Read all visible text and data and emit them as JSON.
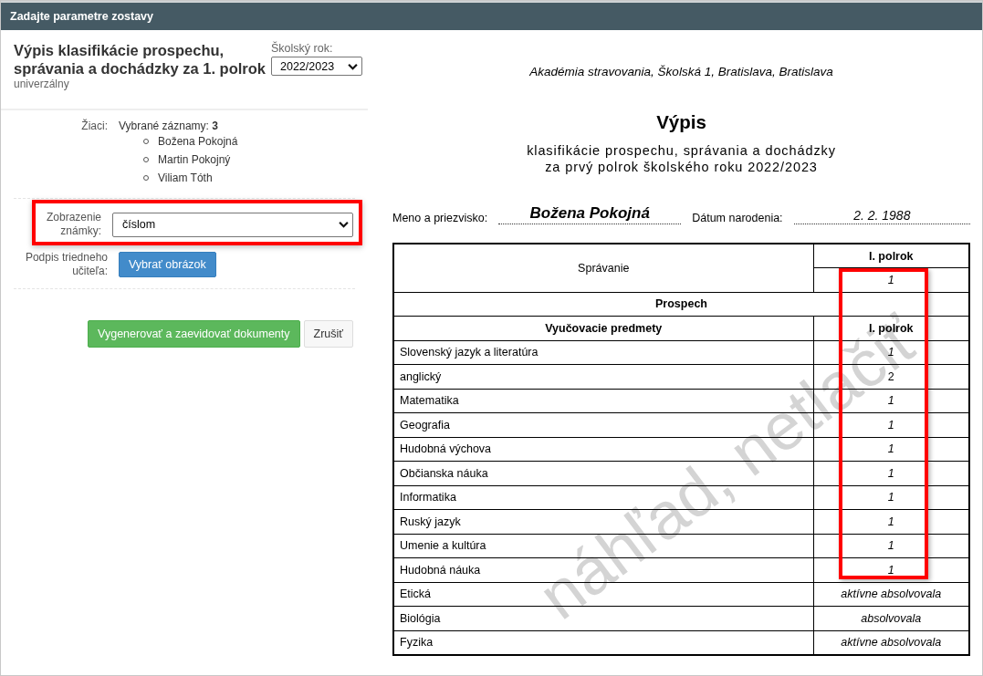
{
  "window": {
    "title": "Zadajte parametre zostavy"
  },
  "params": {
    "heading": "Výpis klasifikácie prospechu, správania a dochádzky za 1. polrok",
    "subtitle": "univerzálny",
    "school_year": {
      "label": "Školský rok:",
      "value": "2022/2023"
    },
    "students": {
      "label": "Žiaci:",
      "summary": "Vybrané záznamy: **3**",
      "names": [
        "Božena Pokojná",
        "Martin Pokojný",
        "Viliam Tóth"
      ]
    },
    "grade_display": {
      "label": "Zobrazenie známky:",
      "value": "číslom",
      "highlighted": true
    },
    "signature": {
      "label": "Podpis triedneho učiteľa:",
      "button": "Vybrať obrázok"
    },
    "buttons": [
      {
        "label": "Vygenerovať a zaevidovať dokumenty",
        "kind": "primary"
      },
      {
        "label": "Zrušiť",
        "kind": "default"
      }
    ]
  },
  "report": {
    "school": "Akadémia stravovania, Školská 1, Bratislava, Bratislava",
    "title": "Výpis",
    "subtitle_lines": [
      "klasifikácie prospechu, správania a dochádzky",
      "za prvý polrok školského roku 2022/2023"
    ],
    "name_label": "Meno a priezvisko:",
    "name": "Božena Pokojná",
    "birth_label": "Dátum narodenia:",
    "birth_date": "2. 2. 1988",
    "behavior": {
      "label": "Správanie",
      "period": "I. polrok",
      "grade": "1"
    },
    "section": "Prospech",
    "columns": [
      "Vyučovacie predmety",
      "I. polrok"
    ],
    "subjects": [
      {
        "name": "Slovenský jazyk a literatúra",
        "grade": "1",
        "italic": true
      },
      {
        "name": "anglický",
        "grade": "2",
        "italic": false
      },
      {
        "name": "Matematika",
        "grade": "1",
        "italic": true
      },
      {
        "name": "Geografia",
        "grade": "1",
        "italic": true
      },
      {
        "name": "Hudobná výchova",
        "grade": "1",
        "italic": true
      },
      {
        "name": "Občianska náuka",
        "grade": "1",
        "italic": true
      },
      {
        "name": "Informatika",
        "grade": "1",
        "italic": true
      },
      {
        "name": "Ruský jazyk",
        "grade": "1",
        "italic": true
      },
      {
        "name": "Umenie a kultúra",
        "grade": "1",
        "italic": true
      },
      {
        "name": "Hudobná náuka",
        "grade": "1",
        "italic": true
      },
      {
        "name": "Etická",
        "grade": "aktívne absolvovala",
        "italic": true
      },
      {
        "name": "Biológia",
        "grade": "absolvovala",
        "italic": true
      },
      {
        "name": "Fyzika",
        "grade": "aktívne absolvovala",
        "italic": true
      }
    ],
    "grades_highlighted": true,
    "watermark": "náhľad, netlačiť"
  }
}
